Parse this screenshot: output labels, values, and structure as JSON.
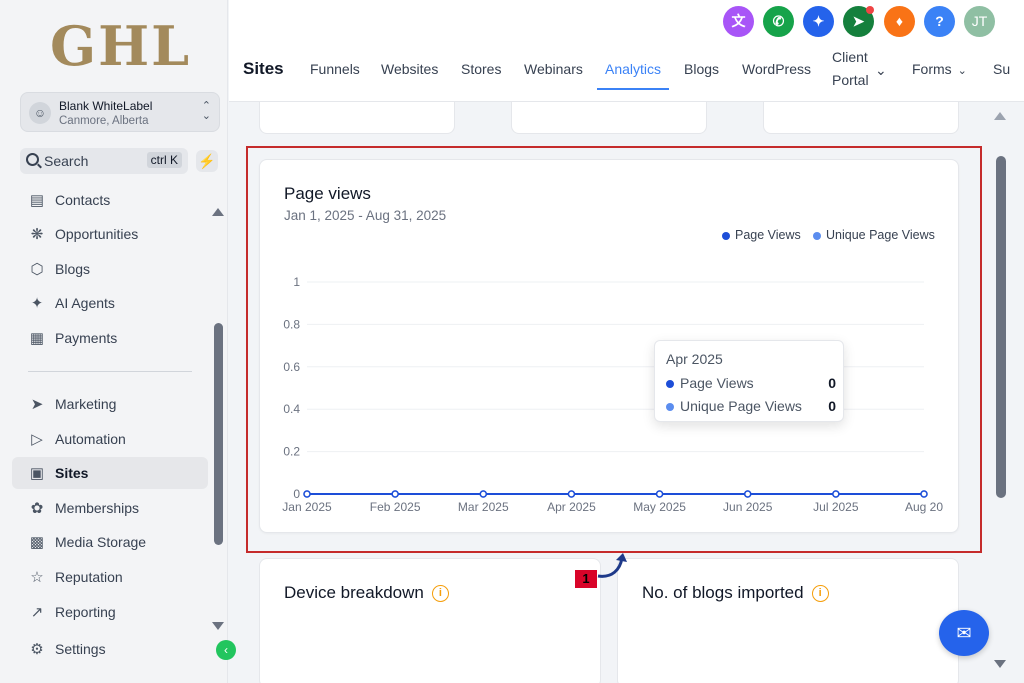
{
  "brand": {
    "logo_text": "GHL"
  },
  "account": {
    "name": "Blank WhiteLabel",
    "location": "Canmore, Alberta"
  },
  "search": {
    "label": "Search",
    "shortcut": "ctrl K"
  },
  "sidebar": {
    "items": [
      {
        "label": "Contacts",
        "icon": "contacts-icon"
      },
      {
        "label": "Opportunities",
        "icon": "opportunities-icon"
      },
      {
        "label": "Blogs",
        "icon": "cube-icon"
      },
      {
        "label": "AI Agents",
        "icon": "sparkle-icon"
      },
      {
        "label": "Payments",
        "icon": "receipt-icon"
      },
      {
        "label": "Marketing",
        "icon": "send-icon"
      },
      {
        "label": "Automation",
        "icon": "play-circle-icon"
      },
      {
        "label": "Sites",
        "icon": "site-icon",
        "active": true
      },
      {
        "label": "Memberships",
        "icon": "badge-icon"
      },
      {
        "label": "Media Storage",
        "icon": "image-icon"
      },
      {
        "label": "Reputation",
        "icon": "star-icon"
      },
      {
        "label": "Reporting",
        "icon": "trend-icon"
      },
      {
        "label": "Settings",
        "icon": "gear-icon"
      }
    ]
  },
  "header": {
    "user_initials": "JT",
    "help": "?",
    "section_title": "Sites",
    "tabs": [
      "Funnels",
      "Websites",
      "Stores",
      "Webinars",
      "Analytics",
      "Blogs",
      "WordPress",
      "Client",
      "Portal",
      "Forms",
      "Su"
    ],
    "active_tab": "Analytics"
  },
  "page_views_card": {
    "title": "Page views",
    "date_range": "Jan 1, 2025 - Aug 31, 2025",
    "legend": [
      {
        "name": "Page Views",
        "color": "#1d4ed8"
      },
      {
        "name": "Unique Page Views",
        "color": "#5b8def"
      }
    ],
    "tooltip": {
      "title": "Apr 2025",
      "rows": [
        {
          "name": "Page Views",
          "value": "0",
          "color": "#1d4ed8"
        },
        {
          "name": "Unique Page Views",
          "value": "0",
          "color": "#5b8def"
        }
      ]
    }
  },
  "chart_data": {
    "type": "line",
    "categories": [
      "Jan 2025",
      "Feb 2025",
      "Mar 2025",
      "Apr 2025",
      "May 2025",
      "Jun 2025",
      "Jul 2025",
      "Aug 20"
    ],
    "series": [
      {
        "name": "Page Views",
        "values": [
          0,
          0,
          0,
          0,
          0,
          0,
          0,
          0
        ],
        "color": "#1d4ed8"
      },
      {
        "name": "Unique Page Views",
        "values": [
          0,
          0,
          0,
          0,
          0,
          0,
          0,
          0
        ],
        "color": "#5b8def"
      }
    ],
    "y_ticks": [
      "1",
      "0.8",
      "0.6",
      "0.4",
      "0.2",
      "0"
    ],
    "ylim": [
      0,
      1
    ],
    "grid": true,
    "legend_position": "top-right"
  },
  "device_card": {
    "title": "Device breakdown"
  },
  "blogs_card": {
    "title": "No. of blogs imported"
  },
  "annotation": {
    "marker": "1"
  }
}
